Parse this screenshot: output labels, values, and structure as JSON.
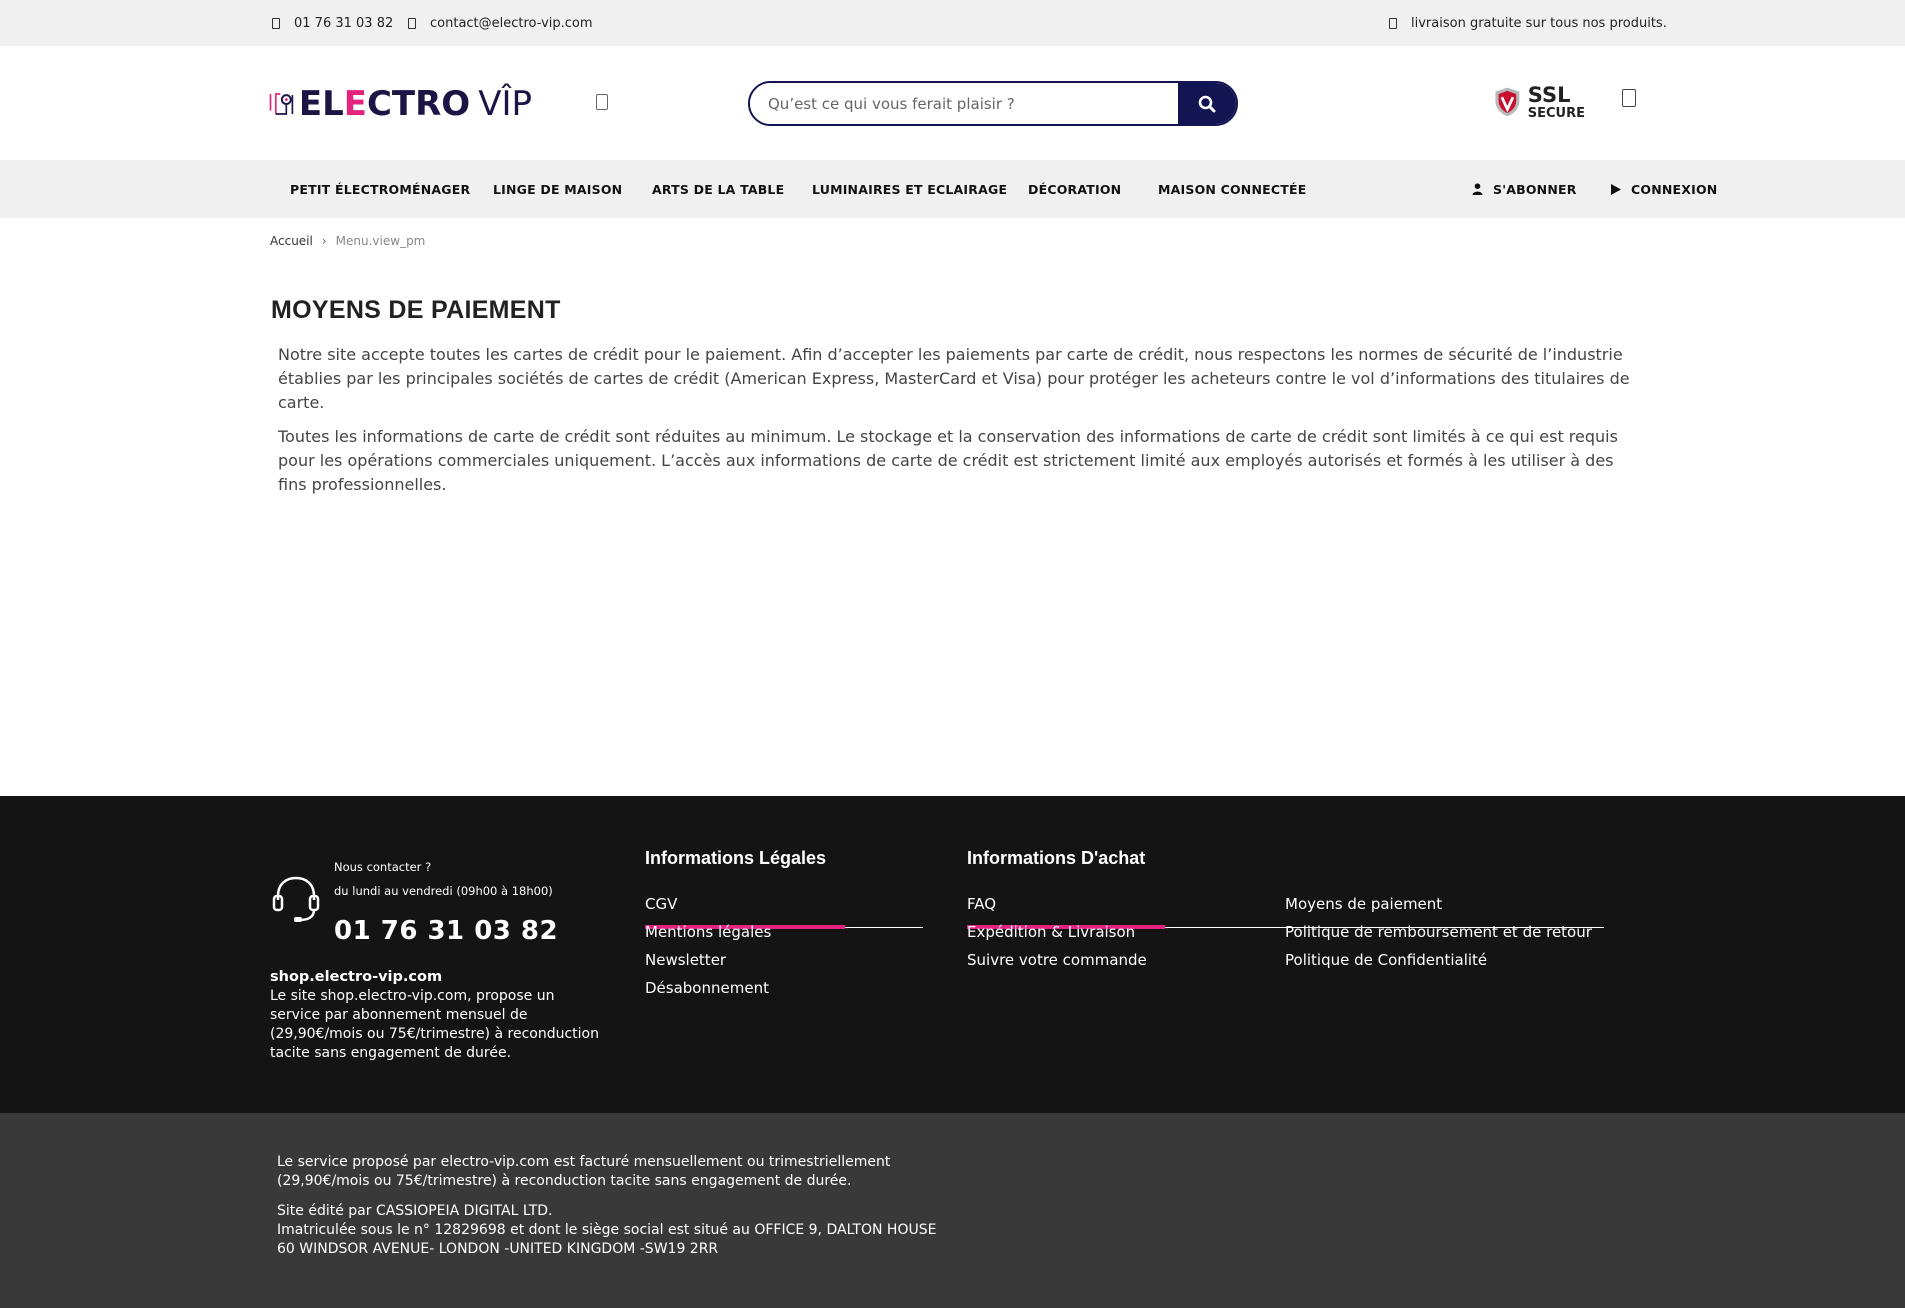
{
  "topbar": {
    "phone": "01 76 31 03 82",
    "email": "contact@electro-vip.com",
    "shipping": "livraison gratuite sur tous nos produits."
  },
  "header": {
    "logo_part1": "EL",
    "logo_part2": "E",
    "logo_part3": "CTRO",
    "logo_part4": "VÎP",
    "search_placeholder": "Qu’est ce qui vous ferait plaisir ?",
    "ssl_big": "SSL",
    "ssl_small": "SECURE"
  },
  "nav": {
    "items": [
      "PETIT ÉLECTROMÉNAGER",
      "LINGE DE MAISON",
      "ARTS DE LA TABLE",
      "LUMINAIRES ET ECLAIRAGE",
      "DÉCORATION",
      "MAISON CONNECTÉE"
    ],
    "subscribe": "S'ABONNER",
    "login": "CONNEXION"
  },
  "breadcrumb": {
    "home": "Accueil",
    "separator": "›",
    "current": "Menu.view_pm"
  },
  "main": {
    "title": "MOYENS DE PAIEMENT",
    "paragraphs": [
      "Notre site accepte toutes les cartes de crédit pour le paiement. Afin d’accepter les paiements par carte de crédit, nous respectons les normes de sécurité de l’industrie établies par les principales sociétés de cartes de crédit (American Express, MasterCard et Visa) pour protéger les acheteurs contre le vol d’informations des titulaires de carte.",
      "Toutes les informations de carte de crédit sont réduites au minimum. Le stockage et la conservation des informations de carte de crédit sont limités à ce qui est requis pour les opérations commerciales uniquement. L’accès aux informations de carte de crédit est strictement limité aux employés autorisés et formés à les utiliser à des fins professionnelles."
    ]
  },
  "footer": {
    "contact_label": "Nous contacter ?",
    "contact_hours": "du lundi au vendredi (09h00 à 18h00)",
    "contact_phone": "01 76 31 03 82",
    "site_name": "shop.electro-vip.com",
    "about": "Le site shop.electro-vip.com, propose un service par abonnement mensuel de (29,90€/mois ou 75€/trimestre) à reconduction tacite sans engagement de durée.",
    "legal": {
      "title": "Informations Légales",
      "links": [
        "CGV",
        "Mentions légales",
        "Newsletter",
        "Désabonnement"
      ]
    },
    "purchase": {
      "title": "Informations D'achat",
      "links_col1": [
        "FAQ",
        "Expédition & Livraison",
        "Suivre votre commande"
      ],
      "links_col2": [
        "Moyens de paiement",
        "Politique de remboursement et de retour",
        "Politique de Confidentialité"
      ]
    }
  },
  "bottom": {
    "billing": "Le service proposé par electro-vip.com est facturé mensuellement ou trimestriellement (29,90€/mois ou 75€/trimestre) à reconduction tacite sans engagement de durée.",
    "editor_line1": "Site édité par CASSIOPEIA DIGITAL LTD.",
    "editor_line2": "Imatriculée sous le n° 12829698 et dont le siège social est situé au  OFFICE 9, DALTON HOUSE 60 WINDSOR AVENUE- LONDON -UNITED KINGDOM -SW19 2RR"
  },
  "colors": {
    "brand_navy": "#131452",
    "brand_pink": "#e3237e",
    "footer_bg": "#141414",
    "bottom_bg": "#393939",
    "bar_bg": "#f0f0f0"
  },
  "icons": {
    "topbar_phone": "phone-icon",
    "topbar_email": "mail-icon",
    "topbar_shipping": "truck-icon",
    "search": "search-icon",
    "cart": "cart-icon",
    "subscribe": "user-icon",
    "login": "play-icon",
    "headset": "headset-icon"
  }
}
